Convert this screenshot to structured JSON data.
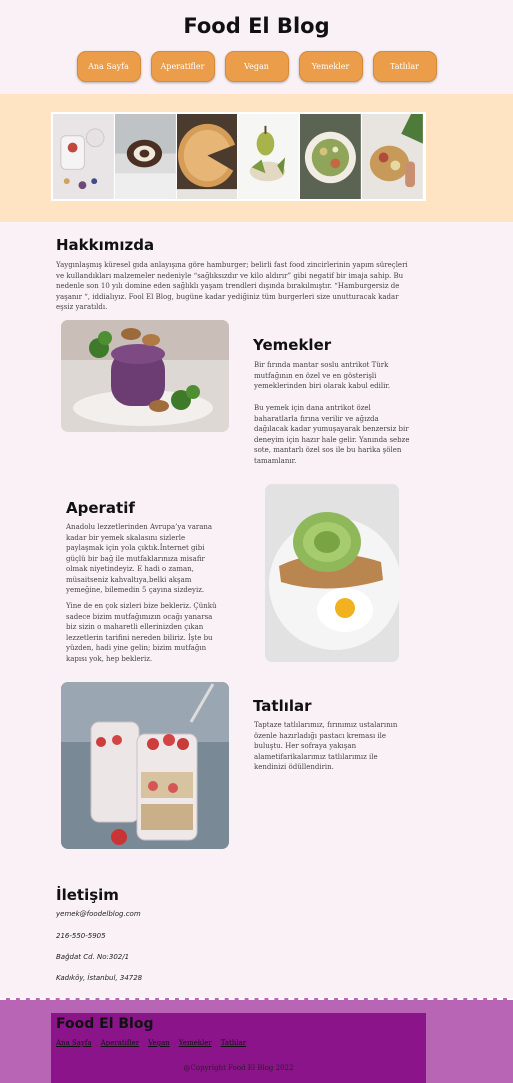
{
  "header": {
    "title": "Food El Blog",
    "nav": [
      "Ana Sayfa",
      "Aperatifler",
      "Vegan",
      "Yemekler",
      "Tatlılar"
    ]
  },
  "colors": {
    "nav_button": "#eb9d49",
    "gallery_band": "#ffe4c3",
    "footer_band": "#b765b4",
    "footer_box": "#8b148a",
    "page_bg": "#f9f1f6"
  },
  "about": {
    "title": "Hakkımızda",
    "text": "Yaygınlaşmış küresel gıda anlayışına göre hamburger; belirli fast food zincirlerinin yapım süreçleri ve kullandıkları malzemeler nedeniyle “sağlıksızdır ve kilo aldırır” gibi negatif bir imaja sahip. Bu nedenle son 10 yılı domine eden sağlıklı yaşam trendleri dışında bırakılmıştır. “Hamburgersiz de yaşanır “, iddialıyız. Fool El Blog, bugüne kadar yediğiniz tüm burgerleri size unutturacak kadar eşsiz yaratıldı."
  },
  "yemekler": {
    "title": "Yemekler",
    "p1": "Bir fırında mantar soslu antrikot Türk mutfağının en özel ve en gösterişli yemeklerinden biri olarak kabul edilir.",
    "p2": "Bu yemek için dana antrikot özel baharatlarla fırına verilir ve ağızda dağılacak kadar yumuşayarak benzersiz bir deneyim için hazır hale gelir. Yanında sebze sote, mantarlı özel sos ile bu harika şölen tamamlanır."
  },
  "aperatif": {
    "title": "Aperatif",
    "p1": "Anadolu lezzetlerinden Avrupa’ya varana kadar bir yemek skalasını sizlerle paylaşmak için yola çıktık.İnternet gibi güçlü bir bağ ile mutfaklarınıza misafir olmak niyetindeyiz. E hadi o zaman, müsaitseniz kahvaltıya,belki akşam yemeğine, bilemedin 5 çayına sizdeyiz.",
    "p2": "Yine de en çok sizleri bize bekleriz. Çünkü sadece bizim mutfağımızın ocağı yanarsa biz sizin o maharetli ellerinizden çıkan lezzetlerin tarifini nereden biliriz. İşte bu yüzden, hadi yine gelin; bizim mutfağın kapısı yok, hep bekleriz."
  },
  "tatlilar": {
    "title": "Tatlılar",
    "p1": "Taptaze tatlılarımız, fırınımız ustalarının özenle hazırladığı pastacı kreması ile buluştu. Her sofraya yakışan alametifarikalarımız tatlılarımız ile kendinizi ödüllendirin."
  },
  "contact": {
    "title": "İletişim",
    "email": "yemek@foodelblog.com",
    "phone": "216-550-5905",
    "street": "Bağdat Cd. No:302/1",
    "city": "Kadıköy, İstanbul, 34728"
  },
  "footer": {
    "title": "Food El Blog",
    "nav": [
      "Ana Sayfa",
      "Aperatifler",
      "Vegan",
      "Yemekler",
      "Tatlılar"
    ],
    "copyright": "@Copyright Food El Blog 2022"
  }
}
